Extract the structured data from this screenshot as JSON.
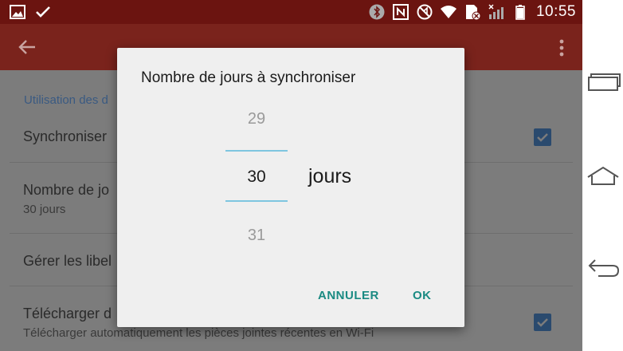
{
  "statusbar": {
    "time": "10:55",
    "left_icons": [
      "image-icon",
      "check-icon"
    ],
    "right_icons": [
      "bluetooth-icon",
      "nfc-icon",
      "mute-icon",
      "wifi-icon",
      "sim-icon",
      "signal-icon",
      "battery-icon"
    ]
  },
  "appbar": {
    "color": "#7a231c"
  },
  "settings": {
    "section_header": "Utilisation des d",
    "rows": [
      {
        "title": "Synchroniser",
        "checked": true
      },
      {
        "title": "Nombre de jo",
        "subtitle": "30 jours"
      },
      {
        "title": "Gérer les libel"
      },
      {
        "title": "Télécharger d",
        "subtitle": "Télécharger automatiquement les pièces jointes récentes en Wi-Fi",
        "checked": true
      }
    ]
  },
  "dialog": {
    "title": "Nombre de jours à synchroniser",
    "picker": {
      "previous": "29",
      "current": "30",
      "next": "31",
      "unit": "jours"
    },
    "cancel_label": "ANNULER",
    "ok_label": "OK"
  },
  "colors": {
    "accent": "#1a8a82",
    "picker_divider": "#7ec6e0",
    "status_bar": "#6b1410"
  },
  "navbar": {
    "buttons": [
      "recent-apps-icon",
      "home-icon",
      "back-icon"
    ]
  }
}
